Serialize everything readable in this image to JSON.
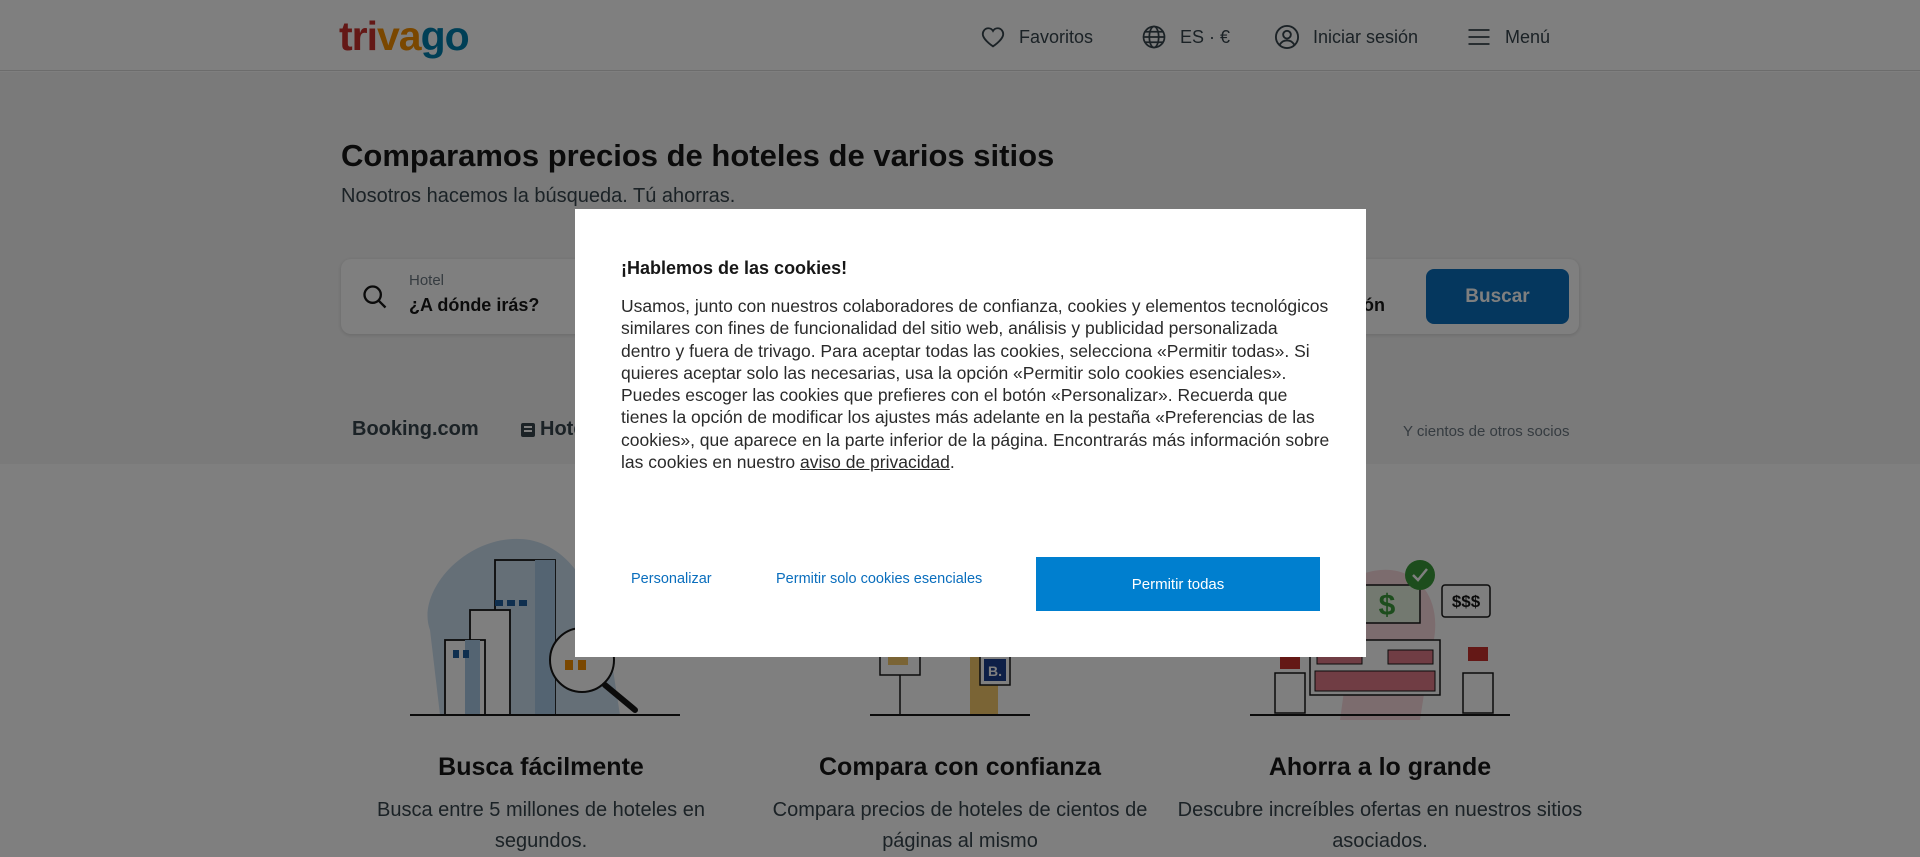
{
  "header": {
    "logo": {
      "part1": "tri",
      "part2": "va",
      "part3": "go"
    },
    "favorites_label": "Favoritos",
    "language_label": "ES · €",
    "login_label": "Iniciar sesión",
    "menu_label": "Menú"
  },
  "hero": {
    "title": "Comparamos precios de hoteles de varios sitios",
    "subtitle": "Nosotros hacemos la búsqueda. Tú ahorras."
  },
  "search": {
    "label": "Hotel",
    "placeholder": "¿A dónde irás?",
    "partial_text": "ón",
    "button_label": "Buscar"
  },
  "partners": {
    "items": [
      "Booking.com",
      "Hote"
    ],
    "more": "Y cientos de otros socios"
  },
  "features": [
    {
      "title": "Busca fácilmente",
      "text": "Busca entre 5 millones de hoteles en segundos."
    },
    {
      "title": "Compara con confianza",
      "text": "Compara precios de hoteles de cientos de páginas al mismo"
    },
    {
      "title": "Ahorra a lo grande",
      "text": "Descubre increíbles ofertas en nuestros sitios asociados."
    }
  ],
  "cookie_modal": {
    "title": "¡Hablemos de las cookies!",
    "paragraph1": "Usamos, junto con nuestros colaboradores de confianza, cookies y elementos tecnológicos similares con fines de funcionalidad del sitio web, análisis y publicidad personalizada dentro y fuera de trivago. Para aceptar todas las cookies, selecciona «Permitir todas». Si quieres aceptar solo las necesarias, usa la opción «Permitir solo cookies esenciales».",
    "paragraph2_start": "Puedes escoger las cookies que prefieres con el botón «Personalizar». Recuerda que tienes la opción de modificar los ajustes más adelante en la pestaña «Preferencias de las cookies», que aparece en la parte inferior de la página. Encontrarás más información sobre las cookies en nuestro ",
    "privacy_link": "aviso de privacidad",
    "paragraph2_end": ".",
    "customize_label": "Personalizar",
    "essential_label": "Permitir solo cookies esenciales",
    "accept_label": "Permitir todas"
  },
  "colors": {
    "brand_red": "#c9302c",
    "brand_orange": "#f48f00",
    "brand_blue": "#007fad",
    "button_blue": "#007fcf"
  }
}
